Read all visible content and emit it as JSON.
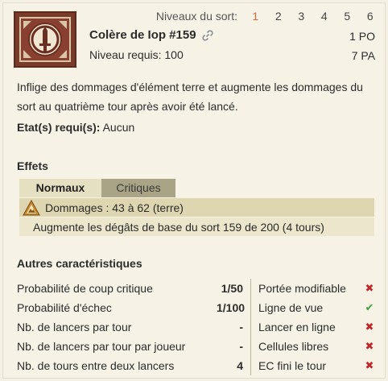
{
  "levels": {
    "label": "Niveaux du sort:",
    "items": [
      "1",
      "2",
      "3",
      "4",
      "5",
      "6"
    ],
    "active": "1"
  },
  "spell": {
    "icon": "spell-sword-icon",
    "name": "Colère de Iop #159",
    "level_required": "Niveau requis: 100",
    "cost_po": "1 PO",
    "cost_pa": "7 PA",
    "description": "Inflige des dommages d'élément terre et augmente les dommages du sort au quatrième tour après avoir été lancé.",
    "states_label": "Etat(s) requi(s):",
    "states_value": "Aucun"
  },
  "effects": {
    "title": "Effets",
    "tabs": [
      "Normaux",
      "Critiques"
    ],
    "active_tab": "Normaux",
    "rows": [
      {
        "icon": "earth-element-icon",
        "text": "Dommages : 43 à 62 (terre)"
      },
      {
        "icon": "",
        "text": "Augmente les dégâts de base du sort 159 de 200 (4 tours)"
      }
    ]
  },
  "characteristics": {
    "title": "Autres caractéristiques",
    "rows": [
      {
        "label": "Probabilité de coup critique",
        "value": "1/50",
        "prop": "Portée modifiable",
        "ok": false
      },
      {
        "label": "Probabilité d'échec",
        "value": "1/100",
        "prop": "Ligne de vue",
        "ok": true
      },
      {
        "label": "Nb. de lancers par tour",
        "value": "-",
        "prop": "Lancer en ligne",
        "ok": false
      },
      {
        "label": "Nb. de lancers par tour par joueur",
        "value": "-",
        "prop": "Cellules libres",
        "ok": false
      },
      {
        "label": "Nb. de tours entre deux lancers",
        "value": "4",
        "prop": "EC fini le tour",
        "ok": false
      }
    ]
  },
  "colors": {
    "active_level": "#e0663a",
    "no": "#c0272d",
    "yes": "#3aa63a"
  }
}
